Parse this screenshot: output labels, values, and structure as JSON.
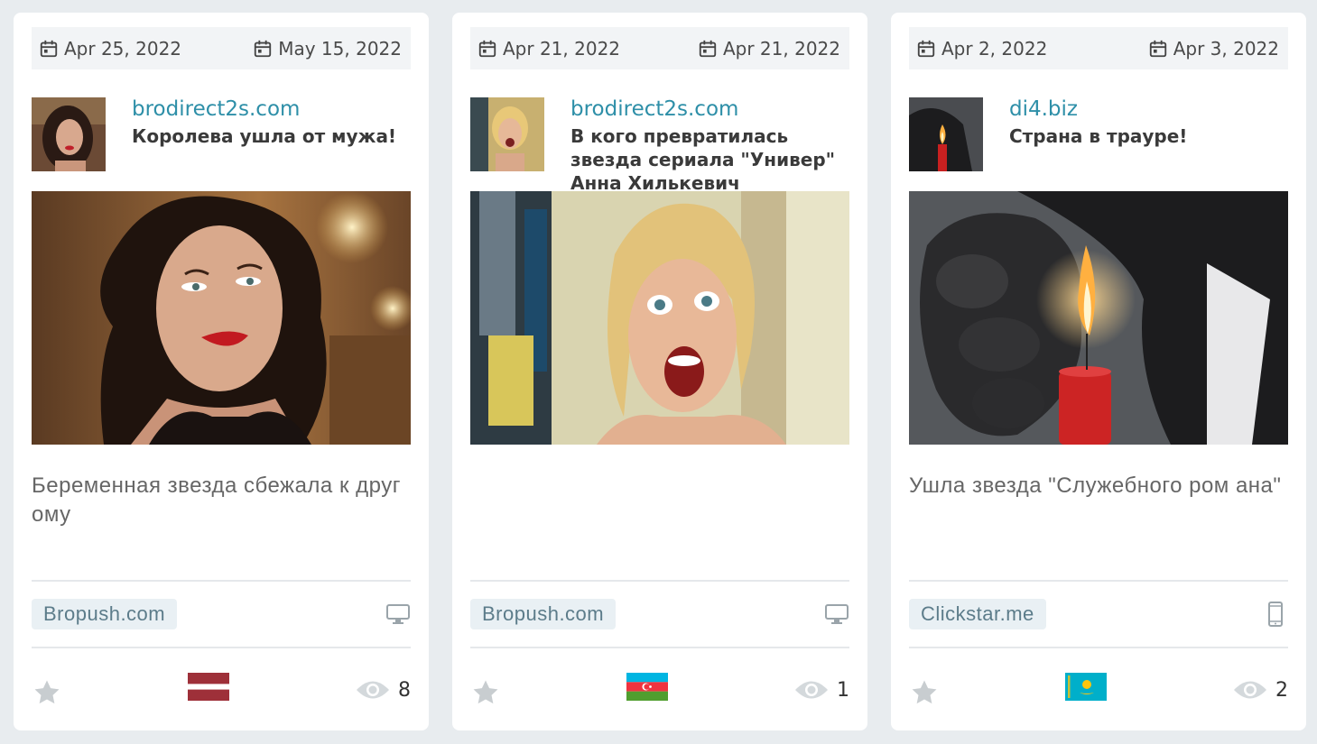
{
  "cards": [
    {
      "date_start": "Apr 25, 2022",
      "date_end": "May 15, 2022",
      "domain": "brodirect2s.com",
      "headline": "Королева ушла от мужа!",
      "description": "Беременная звезда сбежала к другому",
      "network": "Bropush.com",
      "device_icon": "desktop-icon",
      "country_flag": "latvia-flag",
      "views": "8"
    },
    {
      "date_start": "Apr 21, 2022",
      "date_end": "Apr 21, 2022",
      "domain": "brodirect2s.com",
      "headline": "В кого превратилась звезда сериала \"Универ\" Анна Хилькевич",
      "description": "",
      "network": "Bropush.com",
      "device_icon": "desktop-icon",
      "country_flag": "azerbaijan-flag",
      "views": "1"
    },
    {
      "date_start": "Apr 2, 2022",
      "date_end": "Apr 3, 2022",
      "domain": "di4.biz",
      "headline": "Страна в трауре!",
      "description": "Ушла звезда \"Служебного ром ана\"",
      "network": "Clickstar.me",
      "device_icon": "mobile-icon",
      "country_flag": "kazakhstan-flag",
      "views": "2"
    }
  ],
  "colors": {
    "page_bg": "#e8ecef",
    "card_bg": "#ffffff",
    "domain_link": "#2e8fa8",
    "badge_bg": "#e9f0f4"
  }
}
